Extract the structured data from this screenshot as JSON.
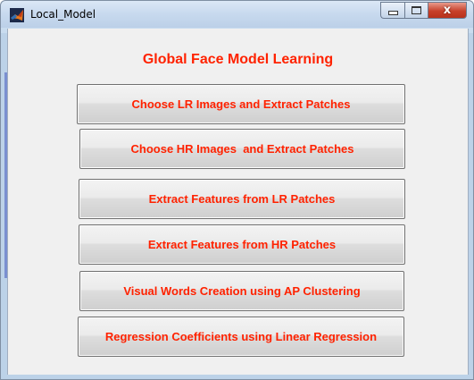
{
  "window": {
    "title": "Local_Model",
    "controls": {
      "minimize": "–",
      "maximize": "□",
      "close": "x"
    }
  },
  "main": {
    "heading": "Global Face Model Learning",
    "buttons": [
      {
        "label": "Choose LR Images and Extract Patches"
      },
      {
        "label": "Choose HR Images  and Extract Patches"
      },
      {
        "label": "Extract Features from LR Patches"
      },
      {
        "label": "Extract Features from HR Patches"
      },
      {
        "label": "Visual Words Creation using AP Clustering"
      },
      {
        "label": "Regression Coefficients using Linear Regression"
      }
    ]
  },
  "colors": {
    "text_accent": "#ff2200",
    "window_frame": "#c9dcef",
    "client_bg": "#f0f0f0"
  },
  "icons": {
    "app": "matlab-logo-icon"
  }
}
